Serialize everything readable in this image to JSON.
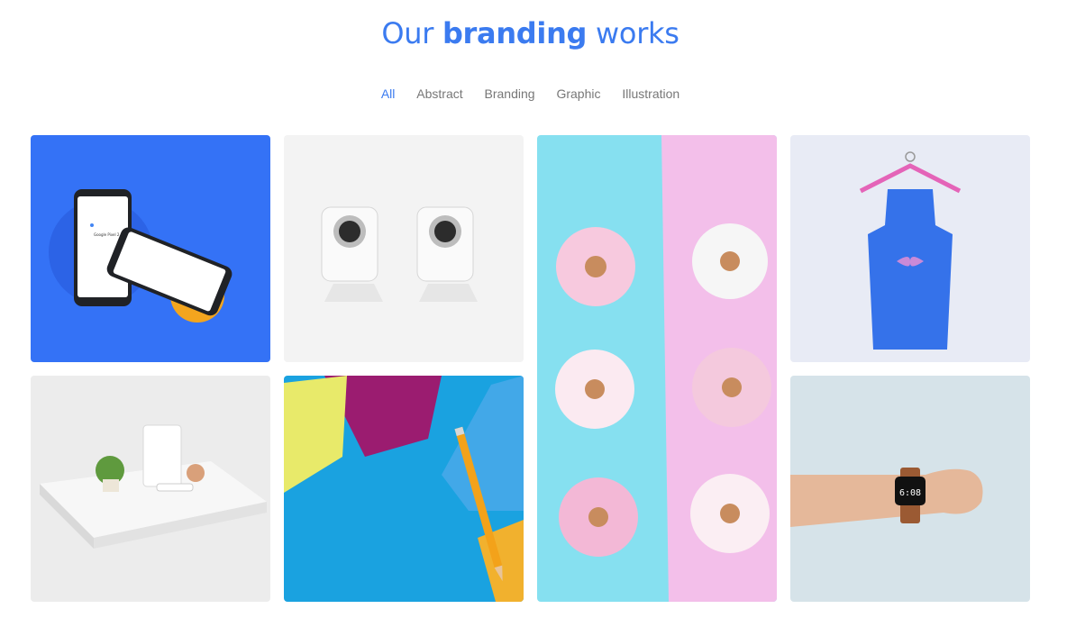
{
  "heading": {
    "prefix": "Our ",
    "emphasis": "branding",
    "suffix": " works"
  },
  "filters": [
    {
      "label": "All",
      "active": true
    },
    {
      "label": "Abstract",
      "active": false
    },
    {
      "label": "Branding",
      "active": false
    },
    {
      "label": "Graphic",
      "active": false
    },
    {
      "label": "Illustration",
      "active": false
    }
  ],
  "colors": {
    "accent": "#3b7bf0",
    "filter_text": "#777777"
  },
  "portfolio": [
    {
      "id": "phone-mockup",
      "icon": "phone-mockup-image"
    },
    {
      "id": "speakers",
      "icon": "speakers-image"
    },
    {
      "id": "donuts",
      "icon": "donuts-image"
    },
    {
      "id": "apron",
      "icon": "apron-image"
    },
    {
      "id": "packaging",
      "icon": "packaging-mockup-image"
    },
    {
      "id": "paper-pencil",
      "icon": "paper-pencil-image"
    },
    {
      "id": "watch",
      "icon": "smartwatch-image"
    }
  ]
}
